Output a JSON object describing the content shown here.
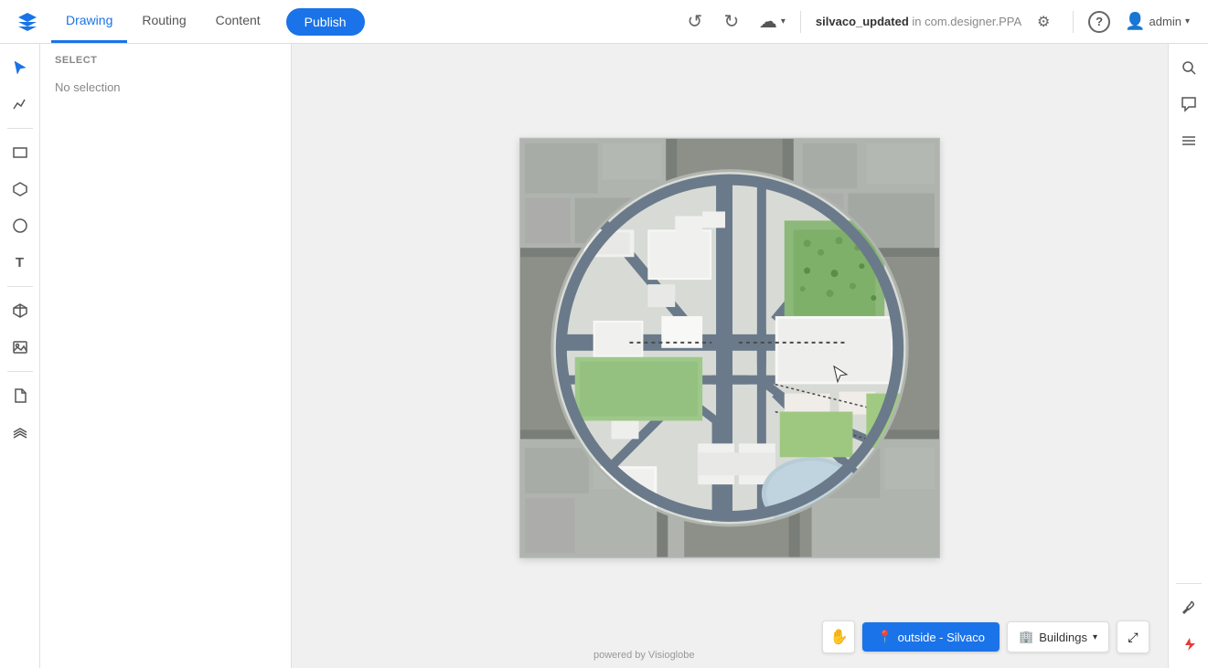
{
  "app": {
    "logo_icon": "✦",
    "title": "silvaco_updated in com.designer.PPA"
  },
  "topbar": {
    "nav_tabs": [
      {
        "id": "drawing",
        "label": "Drawing",
        "active": true
      },
      {
        "id": "routing",
        "label": "Routing",
        "active": false
      },
      {
        "id": "content",
        "label": "Content",
        "active": false
      }
    ],
    "publish_label": "Publish",
    "undo_icon": "↺",
    "redo_icon": "↻",
    "cloud_icon": "☁",
    "dropdown_icon": "▾",
    "project_name": "silvaco_updated",
    "project_path": " in com.designer.PPA",
    "settings_icon": "⚙",
    "help_icon": "?",
    "user_label": "admin",
    "user_dropdown_icon": "▾"
  },
  "left_icon_sidebar": {
    "tools": [
      {
        "id": "select",
        "icon": "↖",
        "active": true
      },
      {
        "id": "graph",
        "icon": "📈"
      },
      {
        "id": "rect",
        "icon": "□"
      },
      {
        "id": "polygon",
        "icon": "⬠"
      },
      {
        "id": "circle",
        "icon": "○"
      },
      {
        "id": "text",
        "icon": "T"
      },
      {
        "id": "box3d",
        "icon": "⬡"
      },
      {
        "id": "image",
        "icon": "🏔"
      },
      {
        "id": "file",
        "icon": "📄"
      },
      {
        "id": "layers",
        "icon": "⧉"
      }
    ]
  },
  "left_panel": {
    "header": "SELECT",
    "no_selection": "No selection"
  },
  "map": {
    "powered_by": "powered by Visioglobe"
  },
  "bottom_bar": {
    "hand_icon": "✋",
    "location_icon": "📍",
    "location_label": "outside - Silvaco",
    "buildings_icon": "🏢",
    "buildings_label": "Buildings",
    "dropdown_icon": "▾",
    "fullscreen_icon": "⤢"
  },
  "right_sidebar": {
    "buttons": [
      {
        "id": "search",
        "icon": "🔍"
      },
      {
        "id": "comments",
        "icon": "💬"
      },
      {
        "id": "list",
        "icon": "≡"
      }
    ],
    "bottom_buttons": [
      {
        "id": "tools",
        "icon": "🔧"
      },
      {
        "id": "flash",
        "icon": "⚡",
        "color": "red"
      }
    ]
  }
}
